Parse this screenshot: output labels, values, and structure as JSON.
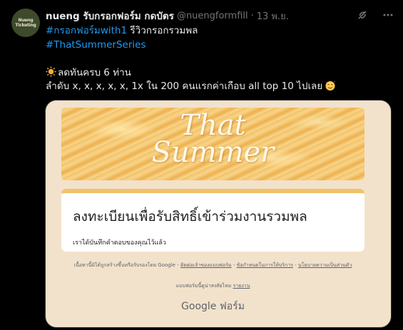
{
  "tweet": {
    "avatar_text_1": "Nueng",
    "avatar_text_2": "Ticketing",
    "display_name": "nueng รับกรอกฟอร์ม กดบัตร",
    "handle": "@nuengformfill",
    "separator": "·",
    "time": "13 พ.ย.",
    "hashtag1": "#กรอกฟอร์มwith1",
    "line1_rest": " รีวิวกรอกรวมพล",
    "hashtag2": "#ThatSummerSeries",
    "line3": "ลดทันครบ 6 ท่าน",
    "line4": "ลำดับ x, x, x, x, x, 1x ใน 200 คนแรกค่าเกือบ all top 10 ไปเลย",
    "icons": [
      "grok-icon",
      "more-icon",
      "sun-emoji",
      "smiling-face-with-hearts-emoji"
    ]
  },
  "form": {
    "banner_title_1": "That",
    "banner_title_2": "Summer",
    "title": "ลงทะเบียนเพื่อรับสิทธิ์เข้าร่วมงานรวมพล",
    "response_msg": "เราได้บันทึกคำตอบของคุณไว้แล้ว",
    "footer_line": "เนื้อหานี้มิได้ถูกสร้างขึ้นหรือรับรองโดย Google -",
    "footer_link1": "ติดต่อเจ้าของแบบฟอร์ม",
    "footer_link2": "ข้อกำหนดในการให้บริการ",
    "footer_link3": "นโยบายความเป็นส่วนตัว",
    "footer2_text": "แบบฟอร์มนี้ดูน่าสงสัยไหม",
    "footer2_link": "รายงาน",
    "google_forms": "Google ฟอร์ม",
    "accent_color": "#f2c26a"
  }
}
